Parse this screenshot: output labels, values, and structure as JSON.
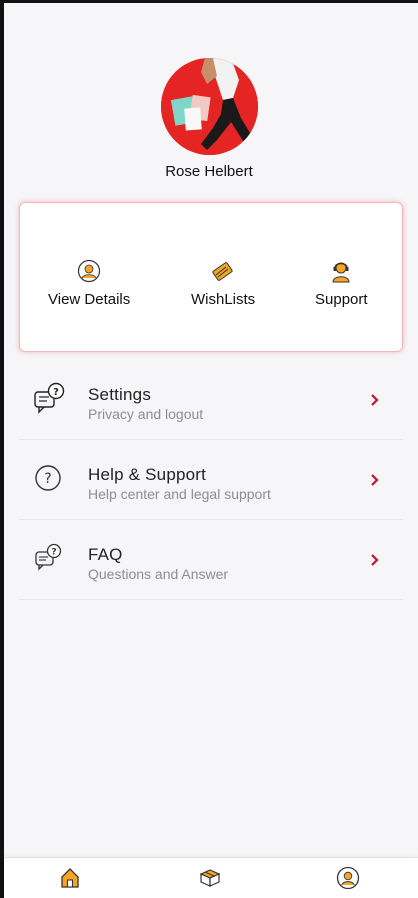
{
  "profile": {
    "name": "Rose Helbert"
  },
  "quick_actions": [
    {
      "label": "View Details",
      "icon": "user-circle-icon"
    },
    {
      "label": "WishLists",
      "icon": "card-icon"
    },
    {
      "label": "Support",
      "icon": "headset-agent-icon"
    }
  ],
  "menu": [
    {
      "title": "Settings",
      "subtitle": "Privacy and logout",
      "icon": "chat-question-icon"
    },
    {
      "title": "Help & Support",
      "subtitle": "Help center and legal support",
      "icon": "question-circle-icon"
    },
    {
      "title": "FAQ",
      "subtitle": "Questions and Answer",
      "icon": "faq-chat-icon"
    }
  ],
  "tabbar": [
    {
      "icon": "home-icon"
    },
    {
      "icon": "box-icon"
    },
    {
      "icon": "profile-icon"
    }
  ],
  "colors": {
    "accent": "#e52424",
    "chevron": "#c8102e",
    "icon_orange": "#f5a623",
    "card_border": "#f4b6b6"
  }
}
